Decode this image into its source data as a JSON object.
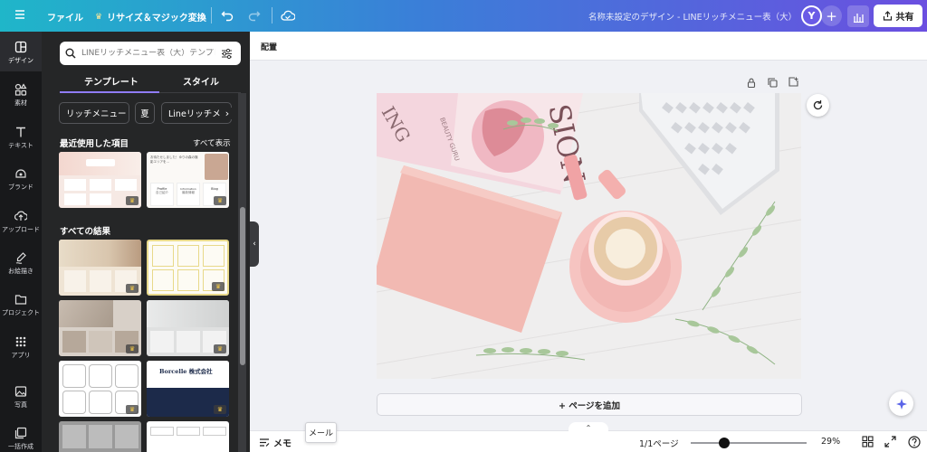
{
  "topbar": {
    "file_label": "ファイル",
    "resize_label": "リサイズ＆マジック変換",
    "doc_title": "名称未設定のデザイン - LINEリッチメニュー表（大）",
    "avatar_initial": "Y",
    "share_label": "共有"
  },
  "rail": {
    "items": [
      {
        "label": "デザイン",
        "icon": "design-icon"
      },
      {
        "label": "素材",
        "icon": "elements-icon"
      },
      {
        "label": "テキスト",
        "icon": "text-icon"
      },
      {
        "label": "ブランド",
        "icon": "brand-icon"
      },
      {
        "label": "アップロード",
        "icon": "upload-icon"
      },
      {
        "label": "お絵描き",
        "icon": "draw-icon"
      },
      {
        "label": "プロジェクト",
        "icon": "folder-icon"
      },
      {
        "label": "アプリ",
        "icon": "apps-icon"
      },
      {
        "label": "写真",
        "icon": "photo-icon"
      },
      {
        "label": "一括作成",
        "icon": "bulk-icon"
      }
    ]
  },
  "panel": {
    "search_placeholder": "LINEリッチメニュー表（大）テンプレ",
    "tab_templates": "テンプレート",
    "tab_styles": "スタイル",
    "chips": [
      "リッチメニュー",
      "夏",
      "Lineリッチメニ"
    ],
    "recent_title": "最近使用した項目",
    "see_all": "すべて表示",
    "all_results_title": "すべての結果",
    "template_texts": {
      "recent2_head": "お待たせしました！ゆりの森の撮影エリアを…",
      "recent2_label1": "Profile",
      "recent2_label2": "Information",
      "recent2_label3": "Blog",
      "recent2_sub1": "自己紹介",
      "recent2_sub2": "最新情報",
      "result_row3_right_logo": "Borcelle 株式会社"
    }
  },
  "canvas": {
    "layout_label": "配置",
    "add_page_label": "+ ページを追加"
  },
  "bottombar": {
    "memo_label": "メモ",
    "tooltip": "メール",
    "pages": "1/1ページ",
    "zoom": "29%",
    "zoom_fraction": 0.29
  },
  "colors": {
    "accent": "#8f7cf8",
    "topbar_start": "#1fb6c9",
    "topbar_end": "#6b4fe0",
    "panel_bg": "#252627",
    "rail_bg": "#18191b"
  }
}
